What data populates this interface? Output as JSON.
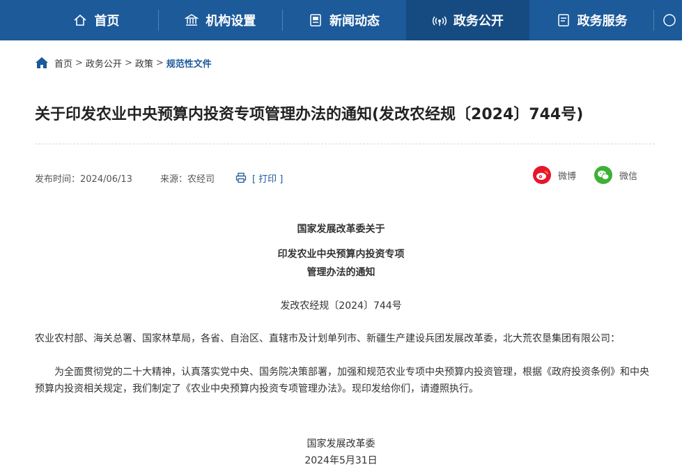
{
  "nav": {
    "items": [
      {
        "label": "首页",
        "icon": "home-icon"
      },
      {
        "label": "机构设置",
        "icon": "institution-icon"
      },
      {
        "label": "新闻动态",
        "icon": "news-icon"
      },
      {
        "label": "政务公开",
        "icon": "broadcast-icon",
        "active": true
      },
      {
        "label": "政务服务",
        "icon": "service-icon"
      }
    ]
  },
  "breadcrumb": {
    "items": [
      "首页",
      "政务公开",
      "政策"
    ],
    "current": "规范性文件",
    "separator": ">"
  },
  "article": {
    "title": "关于印发农业中央预算内投资专项管理办法的通知(发改农经规〔2024〕744号)",
    "publish_label": "发布时间：2024/06/13",
    "source_label": "来源：农经司",
    "print_label": "[ 打印 ]"
  },
  "share": {
    "weibo_label": "微博",
    "wechat_label": "微信"
  },
  "document": {
    "heading_line1": "国家发展改革委关于",
    "heading_line2": "印发农业中央预算内投资专项",
    "heading_line3": "管理办法的通知",
    "doc_number": "发改农经规〔2024〕744号",
    "recipients": "农业农村部、海关总署、国家林草局，各省、自治区、直辖市及计划单列市、新疆生产建设兵团发展改革委，北大荒农垦集团有限公司：",
    "paragraph": "为全面贯彻党的二十大精神，认真落实党中央、国务院决策部署，加强和规范农业专项中央预算内投资管理，根据《政府投资条例》和中央预算内投资相关规定，我们制定了《农业中央预算内投资专项管理办法》。现印发给你们，请遵照执行。",
    "signature_org": "国家发展改革委",
    "signature_date": "2024年5月31日"
  },
  "colors": {
    "nav_bg": "#1c5a9a",
    "nav_active_bg": "#164b82",
    "accent": "#1c5a9a",
    "weibo": "#e6162d",
    "wechat": "#3eb135"
  }
}
